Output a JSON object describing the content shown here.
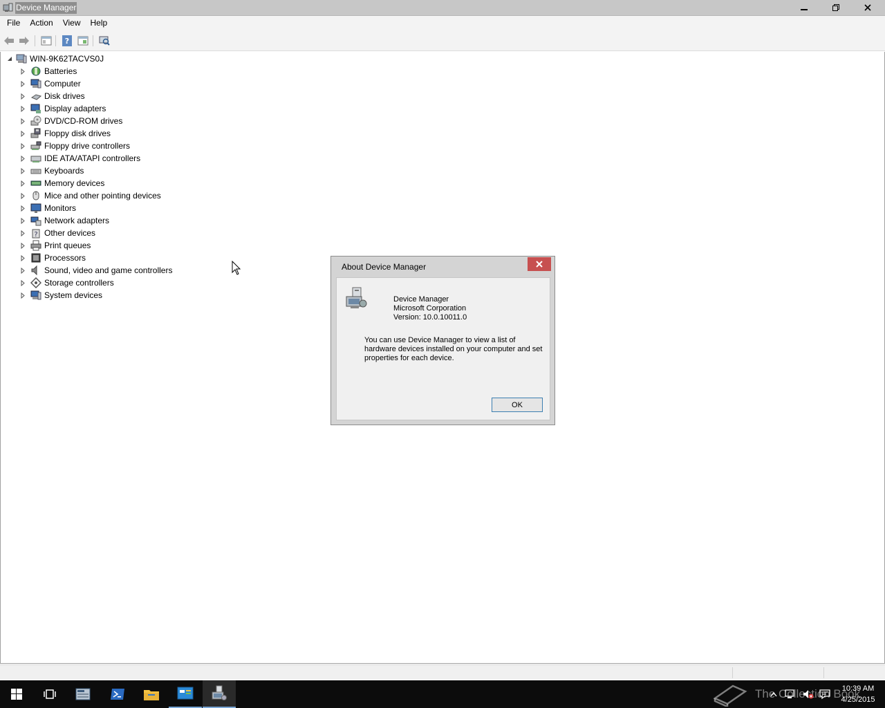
{
  "window": {
    "title": "Device Manager",
    "controls": {
      "minimize": "minimize",
      "restore": "restore",
      "close": "close"
    }
  },
  "menu": [
    "File",
    "Action",
    "View",
    "Help"
  ],
  "toolbar": [
    "back-icon",
    "forward-icon",
    "show-hide-console-tree-icon",
    "help-icon",
    "properties-icon",
    "scan-hardware-icon"
  ],
  "tree": {
    "root": "WIN-9K62TACVS0J",
    "categories": [
      "Batteries",
      "Computer",
      "Disk drives",
      "Display adapters",
      "DVD/CD-ROM drives",
      "Floppy disk drives",
      "Floppy drive controllers",
      "IDE ATA/ATAPI controllers",
      "Keyboards",
      "Memory devices",
      "Mice and other pointing devices",
      "Monitors",
      "Network adapters",
      "Other devices",
      "Print queues",
      "Processors",
      "Sound, video and game controllers",
      "Storage controllers",
      "System devices"
    ]
  },
  "dialog": {
    "title": "About Device Manager",
    "product": "Device Manager",
    "company": "Microsoft Corporation",
    "version": "Version: 10.0.10011.0",
    "description": "You can use Device Manager to view a list of hardware devices installed on your computer and set properties for each device.",
    "ok_label": "OK"
  },
  "taskbar": {
    "time": "10:39 AM",
    "date": "4/25/2015",
    "watermark": "The Collection Book"
  },
  "colors": {
    "title_bar": "#c7c7c7",
    "dialog_close": "#c75050",
    "taskbar": "#0c0c0c",
    "accent": "#7aa7d6"
  }
}
